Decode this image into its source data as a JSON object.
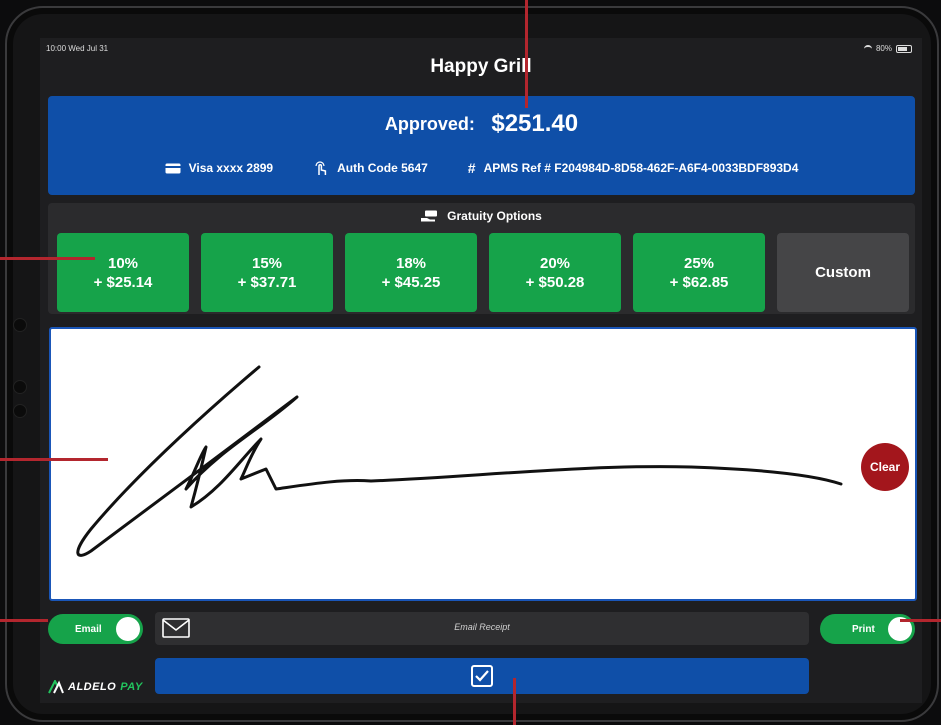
{
  "status_bar": {
    "time_date": "10:00 Wed Jul 31",
    "battery": "80%"
  },
  "header": {
    "title": "Happy Grill"
  },
  "approval": {
    "label": "Approved:",
    "amount": "$251.40",
    "card": "Visa xxxx 2899",
    "auth_code": "Auth Code 5647",
    "ref": "APMS Ref # F204984D-8D58-462F-A6F4-0033BDF893D4"
  },
  "gratuity": {
    "header": "Gratuity Options",
    "options": [
      {
        "percent": "10%",
        "amount": "+ $25.14"
      },
      {
        "percent": "15%",
        "amount": "+ $37.71"
      },
      {
        "percent": "18%",
        "amount": "+ $45.25"
      },
      {
        "percent": "20%",
        "amount": "+ $50.28"
      },
      {
        "percent": "25%",
        "amount": "+ $62.85"
      }
    ],
    "custom_label": "Custom"
  },
  "signature": {
    "clear_label": "Clear"
  },
  "receipt": {
    "email_toggle_label": "Email",
    "email_placeholder": "Email Receipt",
    "print_toggle_label": "Print"
  },
  "branding": {
    "logo_text_main": "ALDELO",
    "logo_text_pay": "PAY"
  },
  "colors": {
    "primary_blue": "#0f4fa8",
    "tip_green": "#16a34a",
    "clear_red": "#a3161c",
    "callout_red": "#b3262e"
  },
  "icons": {
    "card": "credit-card-icon",
    "auth": "touch-icon",
    "ref": "hash-icon",
    "gratuity": "cash-hand-icon",
    "email": "envelope-icon",
    "submit": "checkbox-check-icon"
  }
}
